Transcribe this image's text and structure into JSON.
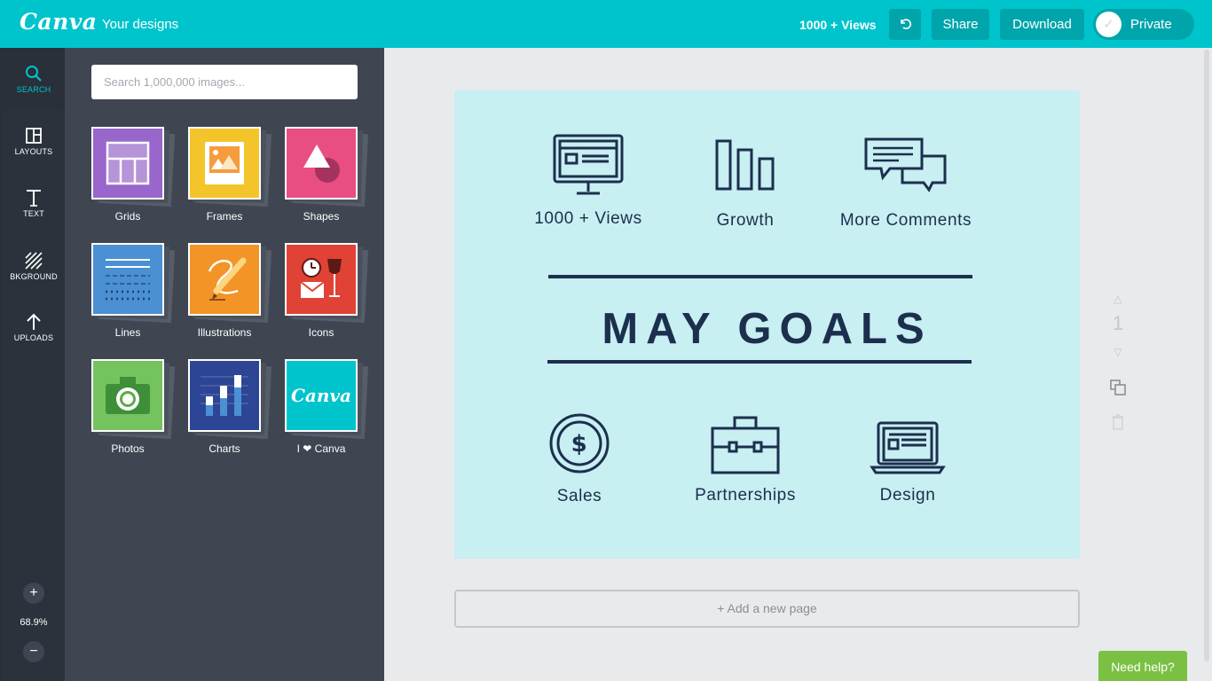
{
  "topbar": {
    "logo": "Canva",
    "your_designs": "Your designs",
    "doc_title": "1000 + Views",
    "undo_icon": "undo-icon",
    "share_label": "Share",
    "download_label": "Download",
    "private_label": "Private",
    "colors": {
      "bar": "#00c4cc",
      "button": "#00a5ab"
    }
  },
  "rail": {
    "items": [
      {
        "label": "SEARCH",
        "icon": "search-icon"
      },
      {
        "label": "LAYOUTS",
        "icon": "layouts-icon"
      },
      {
        "label": "TEXT",
        "icon": "text-icon"
      },
      {
        "label": "BKGROUND",
        "icon": "background-icon"
      },
      {
        "label": "UPLOADS",
        "icon": "upload-icon"
      }
    ],
    "zoom_in": "+",
    "zoom_level": "68.9%",
    "zoom_out": "−"
  },
  "panel": {
    "search_placeholder": "Search 1,000,000 images...",
    "tiles": [
      {
        "label": "Grids",
        "icon": "grid-thumbnail",
        "color": "#9966cc"
      },
      {
        "label": "Frames",
        "icon": "frame-thumbnail",
        "color": "#f4c52b"
      },
      {
        "label": "Shapes",
        "icon": "shapes-thumbnail",
        "color": "#e94e83"
      },
      {
        "label": "Lines",
        "icon": "lines-thumbnail",
        "color": "#4a90d2"
      },
      {
        "label": "Illustrations",
        "icon": "illustration-thumbnail",
        "color": "#f39427"
      },
      {
        "label": "Icons",
        "icon": "icons-thumbnail",
        "color": "#e04235"
      },
      {
        "label": "Photos",
        "icon": "camera-thumbnail",
        "color": "#75c35f"
      },
      {
        "label": "Charts",
        "icon": "chart-thumbnail",
        "color": "#2c4595"
      },
      {
        "label": "I ❤ Canva",
        "icon": "canva-logo-thumbnail",
        "color": "#00c4cc"
      }
    ],
    "canva_tile_text": "Canva"
  },
  "design": {
    "background": "#c8eff2",
    "ink": "#1c2f4d",
    "headline": "MAY GOALS",
    "features_top": [
      {
        "label": "1000 + Views",
        "icon": "monitor-icon"
      },
      {
        "label": "Growth",
        "icon": "bar-chart-icon"
      },
      {
        "label": "More Comments",
        "icon": "chat-bubbles-icon"
      }
    ],
    "features_bottom": [
      {
        "label": "Sales",
        "icon": "dollar-coin-icon"
      },
      {
        "label": "Partnerships",
        "icon": "briefcase-icon"
      },
      {
        "label": "Design",
        "icon": "laptop-icon"
      }
    ]
  },
  "canvas": {
    "add_page": "+ Add a new page",
    "page_number": "1"
  },
  "help": {
    "label": "Need help?"
  }
}
